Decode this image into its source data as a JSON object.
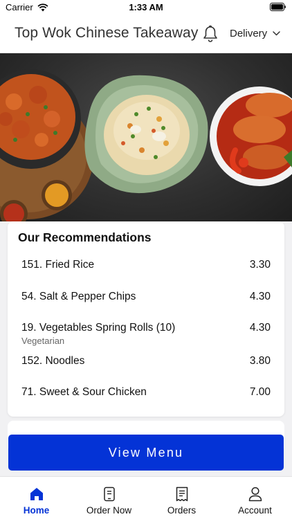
{
  "status_bar": {
    "carrier": "Carrier",
    "time": "1:33 AM"
  },
  "header": {
    "title": "Top Wok Chinese Takeaway",
    "mode": "Delivery"
  },
  "recommendations": {
    "title": "Our Recommendations",
    "items": [
      {
        "name": "151. Fried Rice",
        "price": "3.30"
      },
      {
        "name": "54. Salt & Pepper Chips",
        "price": "4.30"
      },
      {
        "name": "19. Vegetables Spring Rolls (10)",
        "price": "4.30",
        "note": "Vegetarian"
      },
      {
        "name": "152. Noodles",
        "price": "3.80"
      },
      {
        "name": "71. Sweet & Sour Chicken",
        "price": "7.00"
      }
    ]
  },
  "view_menu_label": "View Menu",
  "tabs": [
    {
      "label": "Home",
      "icon": "home-icon",
      "active": true
    },
    {
      "label": "Order Now",
      "icon": "order-now-icon",
      "active": false
    },
    {
      "label": "Orders",
      "icon": "receipt-icon",
      "active": false
    },
    {
      "label": "Account",
      "icon": "account-icon",
      "active": false
    }
  ],
  "colors": {
    "accent": "#0433d6",
    "hero_background": "#333333"
  }
}
